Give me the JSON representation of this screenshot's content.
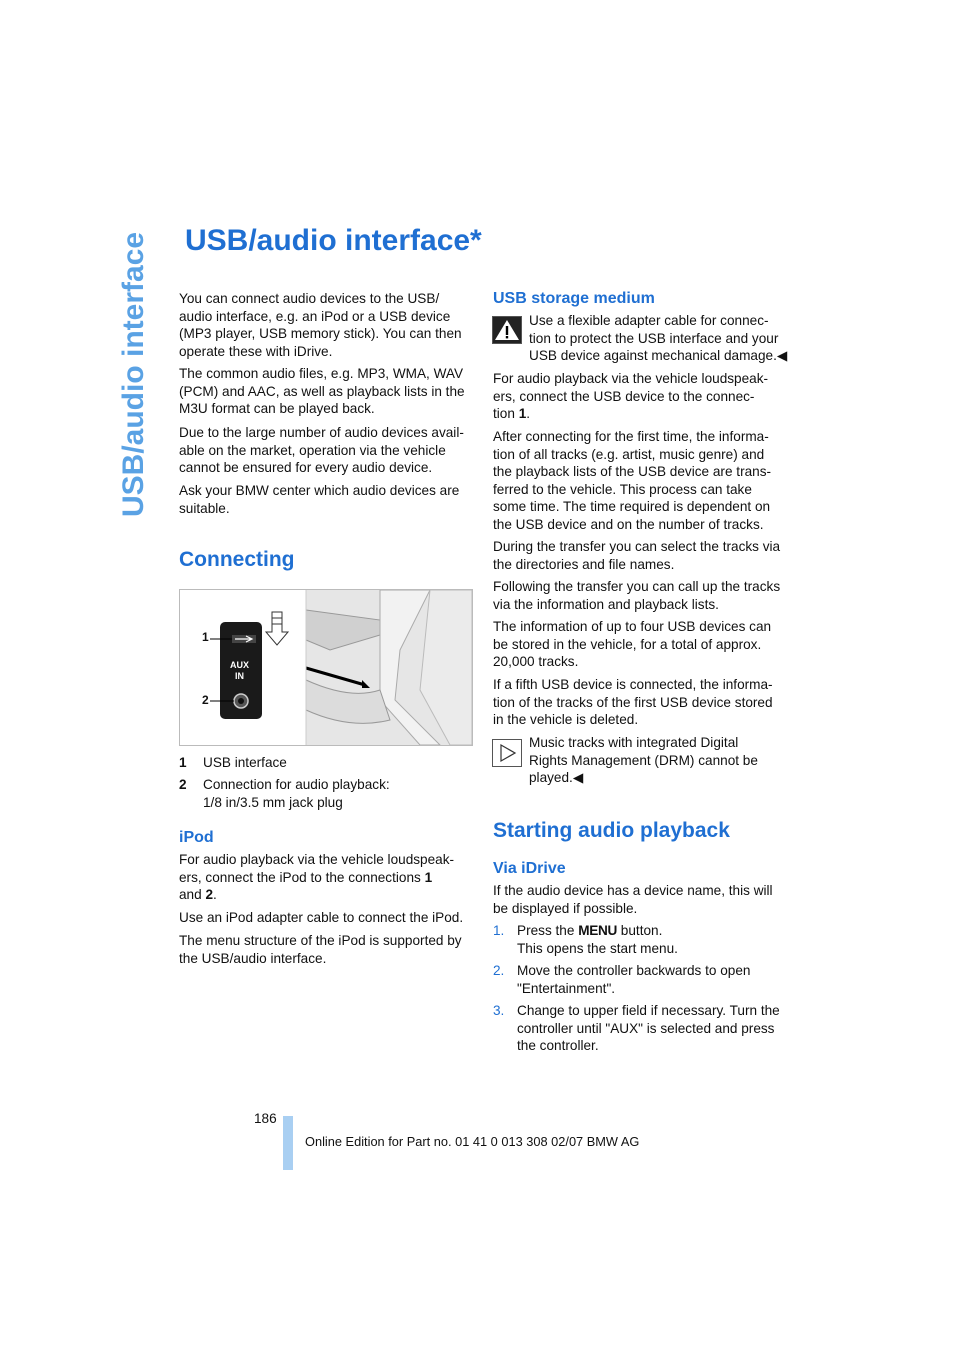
{
  "side_tab": "USB/audio interface",
  "title": "USB/audio interface*",
  "left": {
    "intro": [
      "You can connect audio devices to the USB/\naudio interface, e.g. an iPod or a USB device\n(MP3 player, USB memory stick). You can then\noperate these with iDrive.",
      "The common audio files, e.g. MP3, WMA, WAV\n(PCM) and AAC, as well as playback lists in the\nM3U format can be played back.",
      "Due to the large number of audio devices avail-\nable on the market, operation via the vehicle\ncannot be ensured for every audio device.",
      "Ask your BMW center which audio devices are\nsuitable."
    ],
    "connecting_heading": "Connecting",
    "figure": {
      "label_1": "1",
      "label_2": "2",
      "aux_text_1": "AUX",
      "aux_text_2": "IN"
    },
    "legend": [
      {
        "num": "1",
        "text": "USB interface"
      },
      {
        "num": "2",
        "text": "Connection for audio playback:\n1/8 in/3.5 mm jack plug"
      }
    ],
    "ipod_heading": "iPod",
    "ipod_p1_a": "For audio playback via the vehicle loudspeak-\ners, connect the iPod to the connections ",
    "ipod_p1_b1": "1",
    "ipod_p1_c": "\nand ",
    "ipod_p1_b2": "2",
    "ipod_p1_d": ".",
    "ipod_p2": "Use an iPod adapter cable to connect the iPod.",
    "ipod_p3": "The menu structure of the iPod is supported by\nthe USB/audio interface."
  },
  "right": {
    "usb_heading": "USB storage medium",
    "warning": "Use a flexible adapter cable for connec-\ntion to protect the USB interface and your\nUSB device against mechanical damage.◀",
    "p1_a": "For audio playback via the vehicle loudspeak-\ners, connect the USB device to the connec-\ntion ",
    "p1_b": "1",
    "p1_c": ".",
    "paras": [
      "After connecting for the first time, the informa-\ntion of all tracks (e.g. artist, music genre) and\nthe playback lists of the USB device are trans-\nferred to the vehicle. This process can take\nsome time. The time required is dependent on\nthe USB device and on the number of tracks.",
      "During the transfer you can select the tracks via\nthe directories and file names.",
      "Following the transfer you can call up the tracks\nvia the information and playback lists.",
      "The information of up to four USB devices can\nbe stored in the vehicle, for a total of approx.\n20,000 tracks.",
      "If a fifth USB device is connected, the informa-\ntion of the tracks of the first USB device stored\nin the vehicle is deleted."
    ],
    "note": "Music tracks with integrated Digital\nRights Management (DRM) cannot be\nplayed.◀",
    "playback_heading": "Starting audio playback",
    "idrive_heading": "Via iDrive",
    "idrive_p": "If the audio device has a device name, this will\nbe displayed if possible.",
    "steps": [
      {
        "num": "1.",
        "a": "Press the ",
        "menu": "MENU",
        "b": " button.\nThis opens the start menu."
      },
      {
        "num": "2.",
        "text": "Move the controller backwards to open\n\"Entertainment\"."
      },
      {
        "num": "3.",
        "text": "Change to upper field if necessary. Turn the\ncontroller until \"AUX\" is selected and press\nthe controller."
      }
    ]
  },
  "footer": {
    "page_number": "186",
    "edition": "Online Edition for Part no. 01 41 0 013 308 02/07 BMW AG"
  },
  "colors": {
    "heading_blue": "#1f6fd2",
    "side_tab_blue": "#5aa2e4",
    "footer_bar": "#a9cff2"
  }
}
